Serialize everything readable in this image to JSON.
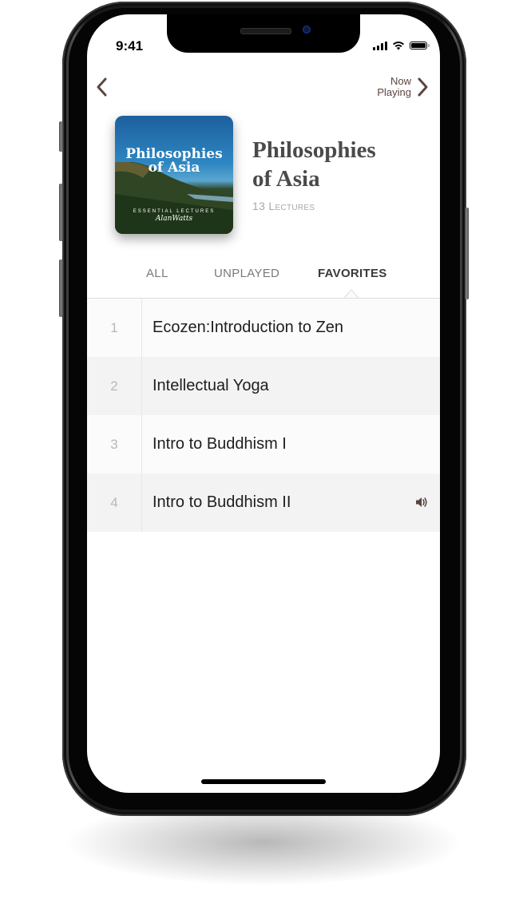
{
  "status_bar": {
    "time": "9:41",
    "icons": [
      "signal-icon",
      "wifi-icon",
      "battery-icon"
    ]
  },
  "nav": {
    "back_icon": "chevron-left-icon",
    "now_playing_label_line1": "Now",
    "now_playing_label_line2": "Playing",
    "forward_icon": "chevron-right-icon"
  },
  "album": {
    "art_title_line1": "Philosophies",
    "art_title_line2": "of Asia",
    "art_subtitle": "ESSENTIAL LECTURES",
    "art_signature": "AlanWatts",
    "title_line1": "Philosophies",
    "title_line2": "of Asia",
    "lecture_count": "13 Lectures"
  },
  "tabs": [
    {
      "label": "ALL",
      "active": false
    },
    {
      "label": "UNPLAYED",
      "active": false
    },
    {
      "label": "FAVORITES",
      "active": true
    }
  ],
  "lectures": [
    {
      "number": "1",
      "title": "Ecozen:Introduction to Zen",
      "playing": false
    },
    {
      "number": "2",
      "title": "Intellectual Yoga",
      "playing": false
    },
    {
      "number": "3",
      "title": "Intro to Buddhism I",
      "playing": false
    },
    {
      "number": "4",
      "title": "Intro to Buddhism II",
      "playing": true,
      "icon": "speaker-icon"
    }
  ],
  "colors": {
    "accent": "#5b4540",
    "title_text": "#4a4a4a",
    "muted_text": "#a8a8a8",
    "row_alt": "#f3f3f3"
  }
}
